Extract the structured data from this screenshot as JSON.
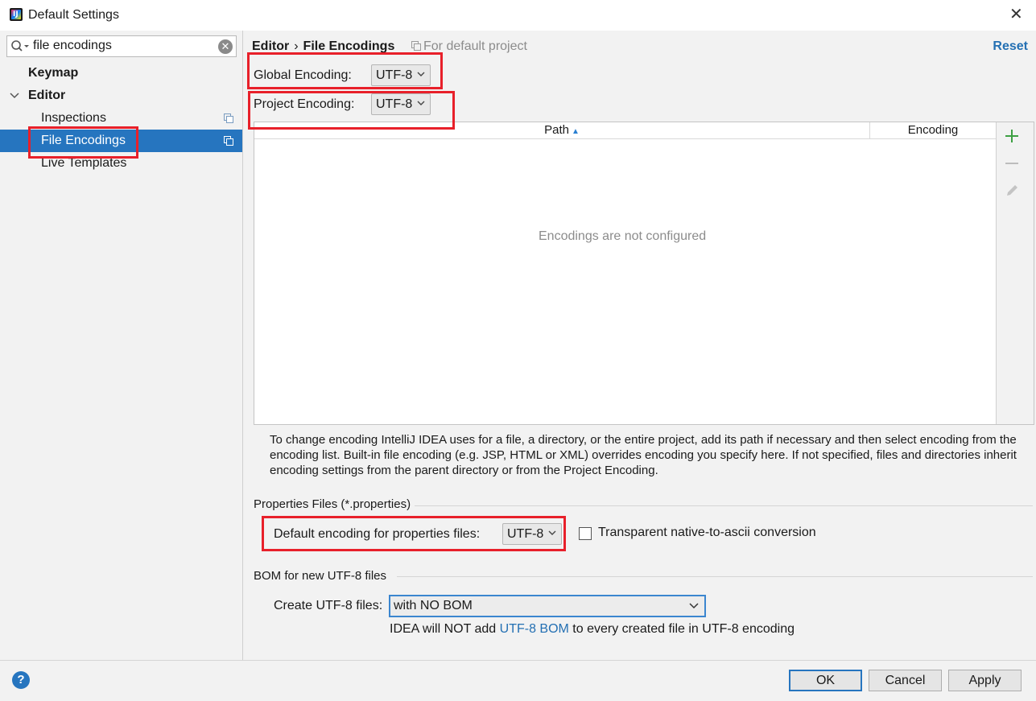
{
  "window": {
    "title": "Default Settings"
  },
  "sidebar": {
    "search_value": "file encodings",
    "items": [
      {
        "label": "Keymap"
      },
      {
        "label": "Editor"
      },
      {
        "label": "Inspections"
      },
      {
        "label": "File Encodings"
      },
      {
        "label": "Live Templates"
      }
    ]
  },
  "header": {
    "breadcrumb_parent": "Editor",
    "breadcrumb_separator": "›",
    "breadcrumb_current": "File Encodings",
    "scope_note": "For default project",
    "reset_label": "Reset"
  },
  "encodings": {
    "global_label": "Global Encoding:",
    "global_value": "UTF-8",
    "project_label": "Project Encoding:",
    "project_value": "UTF-8"
  },
  "table": {
    "columns": [
      "Path",
      "Encoding"
    ],
    "empty_message": "Encodings are not configured"
  },
  "help_text": "To change encoding IntelliJ IDEA uses for a file, a directory, or the entire project, add its path if necessary and then select encoding from the encoding list. Built-in file encoding (e.g. JSP, HTML or XML) overrides encoding you specify here. If not specified, files and directories inherit encoding settings from the parent directory or from the Project Encoding.",
  "properties": {
    "section_title": "Properties Files (*.properties)",
    "default_label": "Default encoding for properties files:",
    "default_value": "UTF-8",
    "transparent_label": "Transparent native-to-ascii conversion",
    "transparent_checked": false
  },
  "bom": {
    "section_title": "BOM for new UTF-8 files",
    "create_label": "Create UTF-8 files:",
    "create_value": "with NO BOM",
    "info_prefix": "IDEA will NOT add ",
    "info_link": "UTF-8 BOM",
    "info_suffix": " to every created file in UTF-8 encoding"
  },
  "footer": {
    "help_label": "?",
    "ok_label": "OK",
    "cancel_label": "Cancel",
    "apply_label": "Apply"
  },
  "colors": {
    "selection": "#2675bf",
    "highlight_box": "#e8202a",
    "link": "#2470b3",
    "add_icon": "#3da043"
  }
}
